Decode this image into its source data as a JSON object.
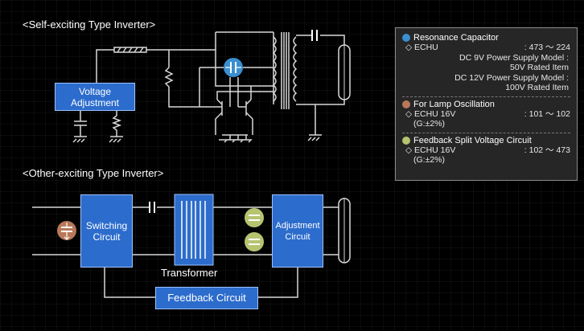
{
  "sections": {
    "self_exciting_title": "<Self-exciting Type Inverter>",
    "other_exciting_title": "<Other-exciting Type Inverter>"
  },
  "blocks": {
    "voltage_adjustment": [
      "Voltage",
      "Adjustment"
    ],
    "switching_circuit": [
      "Switching",
      "Circuit"
    ],
    "adjustment_circuit": [
      "Adjustment",
      "Circuit"
    ],
    "feedback_circuit": "Feedback  Circuit",
    "transformer_label": "Transformer"
  },
  "legend": {
    "resonance": {
      "color": "#3a8fd0",
      "title": "Resonance Capacitor",
      "part": "◇ ECHU",
      "range": ": 473 〜 224",
      "line1": "DC   9V  Power Supply Model :",
      "line2": "50V  Rated Item",
      "line3": "DC 12V  Power Supply Model :",
      "line4": "100V  Rated Item"
    },
    "lamp": {
      "color": "#b8785a",
      "title": "For Lamp Oscillation",
      "part": "◇ ECHU 16V",
      "range": ": 101 〜 102",
      "tolerance": "(G:±2%)"
    },
    "feedback": {
      "color": "#b6c470",
      "title": "Feedback Split Voltage Circuit",
      "part": "◇ ECHU 16V",
      "range": ": 102 〜 473",
      "tolerance": "(G:±2%)"
    }
  },
  "colors": {
    "block_fill": "#2c6ccc",
    "wire": "#d8d8d8",
    "resonance_cap": "#3a8fd0",
    "lamp_cap": "#b8785a",
    "feedback_cap": "#b6c470"
  }
}
